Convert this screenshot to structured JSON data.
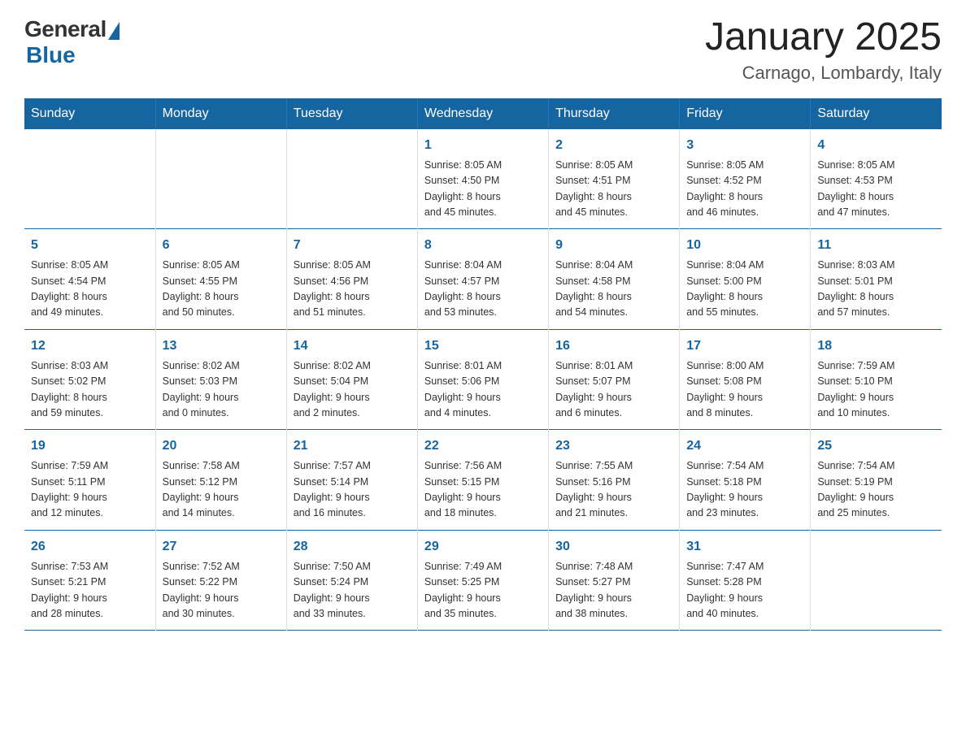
{
  "logo": {
    "general_text": "General",
    "blue_text": "Blue"
  },
  "title": "January 2025",
  "location": "Carnago, Lombardy, Italy",
  "days_of_week": [
    "Sunday",
    "Monday",
    "Tuesday",
    "Wednesday",
    "Thursday",
    "Friday",
    "Saturday"
  ],
  "weeks": [
    [
      {
        "day": "",
        "info": ""
      },
      {
        "day": "",
        "info": ""
      },
      {
        "day": "",
        "info": ""
      },
      {
        "day": "1",
        "info": "Sunrise: 8:05 AM\nSunset: 4:50 PM\nDaylight: 8 hours\nand 45 minutes."
      },
      {
        "day": "2",
        "info": "Sunrise: 8:05 AM\nSunset: 4:51 PM\nDaylight: 8 hours\nand 45 minutes."
      },
      {
        "day": "3",
        "info": "Sunrise: 8:05 AM\nSunset: 4:52 PM\nDaylight: 8 hours\nand 46 minutes."
      },
      {
        "day": "4",
        "info": "Sunrise: 8:05 AM\nSunset: 4:53 PM\nDaylight: 8 hours\nand 47 minutes."
      }
    ],
    [
      {
        "day": "5",
        "info": "Sunrise: 8:05 AM\nSunset: 4:54 PM\nDaylight: 8 hours\nand 49 minutes."
      },
      {
        "day": "6",
        "info": "Sunrise: 8:05 AM\nSunset: 4:55 PM\nDaylight: 8 hours\nand 50 minutes."
      },
      {
        "day": "7",
        "info": "Sunrise: 8:05 AM\nSunset: 4:56 PM\nDaylight: 8 hours\nand 51 minutes."
      },
      {
        "day": "8",
        "info": "Sunrise: 8:04 AM\nSunset: 4:57 PM\nDaylight: 8 hours\nand 53 minutes."
      },
      {
        "day": "9",
        "info": "Sunrise: 8:04 AM\nSunset: 4:58 PM\nDaylight: 8 hours\nand 54 minutes."
      },
      {
        "day": "10",
        "info": "Sunrise: 8:04 AM\nSunset: 5:00 PM\nDaylight: 8 hours\nand 55 minutes."
      },
      {
        "day": "11",
        "info": "Sunrise: 8:03 AM\nSunset: 5:01 PM\nDaylight: 8 hours\nand 57 minutes."
      }
    ],
    [
      {
        "day": "12",
        "info": "Sunrise: 8:03 AM\nSunset: 5:02 PM\nDaylight: 8 hours\nand 59 minutes."
      },
      {
        "day": "13",
        "info": "Sunrise: 8:02 AM\nSunset: 5:03 PM\nDaylight: 9 hours\nand 0 minutes."
      },
      {
        "day": "14",
        "info": "Sunrise: 8:02 AM\nSunset: 5:04 PM\nDaylight: 9 hours\nand 2 minutes."
      },
      {
        "day": "15",
        "info": "Sunrise: 8:01 AM\nSunset: 5:06 PM\nDaylight: 9 hours\nand 4 minutes."
      },
      {
        "day": "16",
        "info": "Sunrise: 8:01 AM\nSunset: 5:07 PM\nDaylight: 9 hours\nand 6 minutes."
      },
      {
        "day": "17",
        "info": "Sunrise: 8:00 AM\nSunset: 5:08 PM\nDaylight: 9 hours\nand 8 minutes."
      },
      {
        "day": "18",
        "info": "Sunrise: 7:59 AM\nSunset: 5:10 PM\nDaylight: 9 hours\nand 10 minutes."
      }
    ],
    [
      {
        "day": "19",
        "info": "Sunrise: 7:59 AM\nSunset: 5:11 PM\nDaylight: 9 hours\nand 12 minutes."
      },
      {
        "day": "20",
        "info": "Sunrise: 7:58 AM\nSunset: 5:12 PM\nDaylight: 9 hours\nand 14 minutes."
      },
      {
        "day": "21",
        "info": "Sunrise: 7:57 AM\nSunset: 5:14 PM\nDaylight: 9 hours\nand 16 minutes."
      },
      {
        "day": "22",
        "info": "Sunrise: 7:56 AM\nSunset: 5:15 PM\nDaylight: 9 hours\nand 18 minutes."
      },
      {
        "day": "23",
        "info": "Sunrise: 7:55 AM\nSunset: 5:16 PM\nDaylight: 9 hours\nand 21 minutes."
      },
      {
        "day": "24",
        "info": "Sunrise: 7:54 AM\nSunset: 5:18 PM\nDaylight: 9 hours\nand 23 minutes."
      },
      {
        "day": "25",
        "info": "Sunrise: 7:54 AM\nSunset: 5:19 PM\nDaylight: 9 hours\nand 25 minutes."
      }
    ],
    [
      {
        "day": "26",
        "info": "Sunrise: 7:53 AM\nSunset: 5:21 PM\nDaylight: 9 hours\nand 28 minutes."
      },
      {
        "day": "27",
        "info": "Sunrise: 7:52 AM\nSunset: 5:22 PM\nDaylight: 9 hours\nand 30 minutes."
      },
      {
        "day": "28",
        "info": "Sunrise: 7:50 AM\nSunset: 5:24 PM\nDaylight: 9 hours\nand 33 minutes."
      },
      {
        "day": "29",
        "info": "Sunrise: 7:49 AM\nSunset: 5:25 PM\nDaylight: 9 hours\nand 35 minutes."
      },
      {
        "day": "30",
        "info": "Sunrise: 7:48 AM\nSunset: 5:27 PM\nDaylight: 9 hours\nand 38 minutes."
      },
      {
        "day": "31",
        "info": "Sunrise: 7:47 AM\nSunset: 5:28 PM\nDaylight: 9 hours\nand 40 minutes."
      },
      {
        "day": "",
        "info": ""
      }
    ]
  ]
}
